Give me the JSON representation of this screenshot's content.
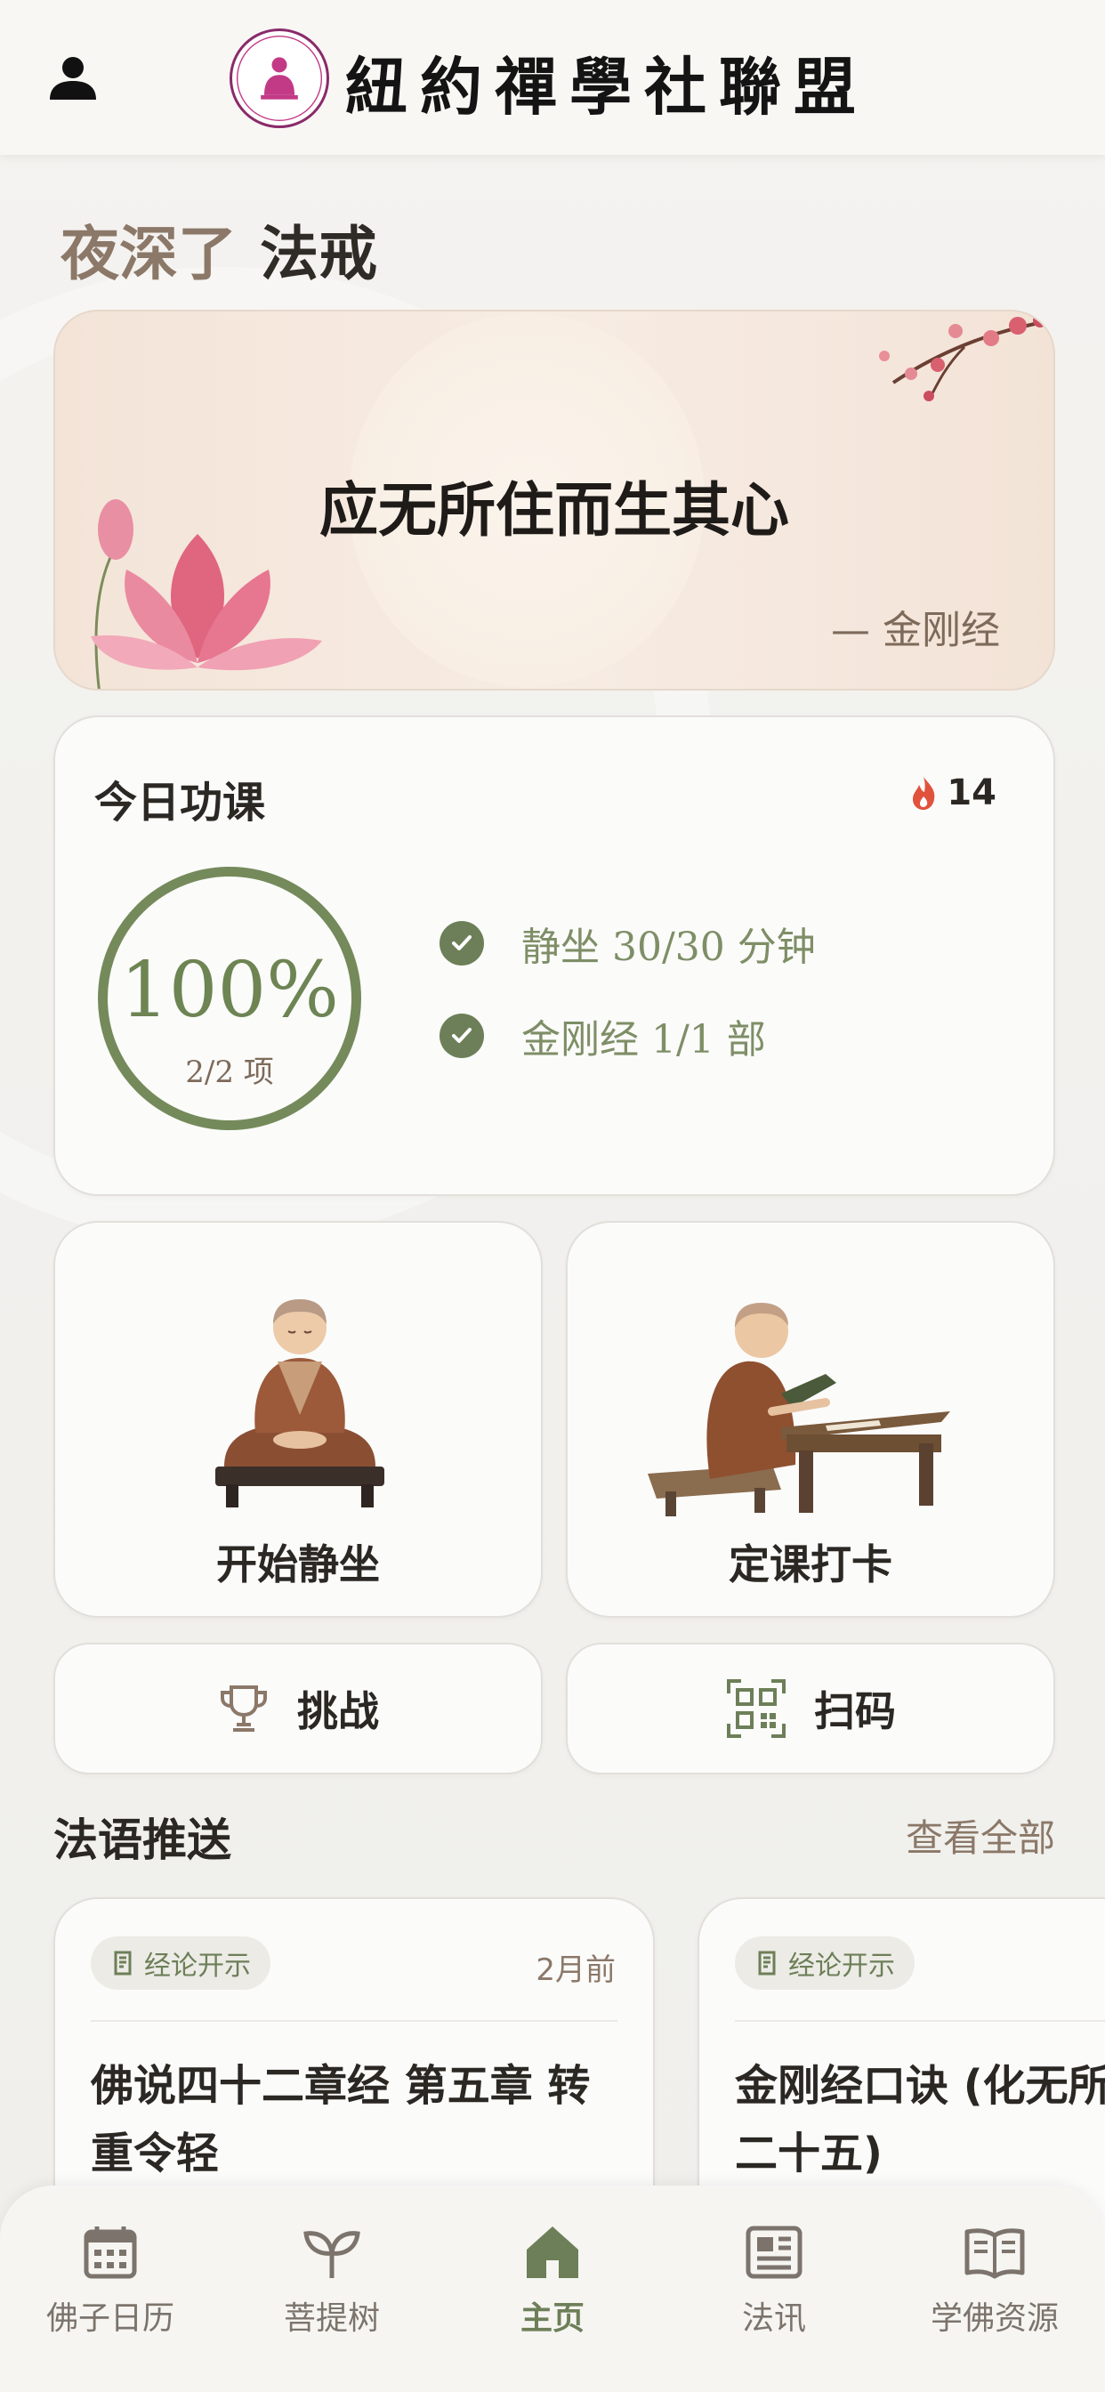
{
  "header": {
    "title": "紐約禪學社聯盟",
    "logo_text": "New York Zen Buddhism Club Alliance",
    "user_icon": "user-icon"
  },
  "greeting": {
    "time_text": "夜深了",
    "user_name": "法戒"
  },
  "quote": {
    "text": "应无所住而生其心",
    "source": "— 金刚经"
  },
  "practice": {
    "title": "今日功课",
    "streak_icon": "flame-icon",
    "streak": "14",
    "progress_fraction": 1.0,
    "percent_text": "100%",
    "count_text": "2/2 项",
    "tasks": [
      {
        "label": "静坐 30/30 分钟",
        "done": true
      },
      {
        "label": "金刚经 1/1 部",
        "done": true
      }
    ]
  },
  "actions": {
    "meditate_label": "开始静坐",
    "checkin_label": "定课打卡",
    "challenge_label": "挑战",
    "scan_label": "扫码"
  },
  "dharma": {
    "section_title": "法语推送",
    "see_all": "查看全部",
    "posts": [
      {
        "tag": "经论开示",
        "time": "2月前",
        "title": "佛说四十二章经 第五章 转\n重令轻"
      },
      {
        "tag": "经论开示",
        "time": "",
        "title": "金刚经口诀 (化无所\n二十五)"
      }
    ]
  },
  "nav": {
    "items": [
      {
        "label": "佛子日历",
        "icon": "calendar-icon"
      },
      {
        "label": "菩提树",
        "icon": "sprout-icon"
      },
      {
        "label": "主页",
        "icon": "home-icon",
        "active": true
      },
      {
        "label": "法讯",
        "icon": "news-icon"
      },
      {
        "label": "学佛资源",
        "icon": "book-icon"
      }
    ]
  },
  "colors": {
    "accent_green": "#6d7f58",
    "warm_brown": "#8b7868",
    "flame": "#e0523c"
  }
}
